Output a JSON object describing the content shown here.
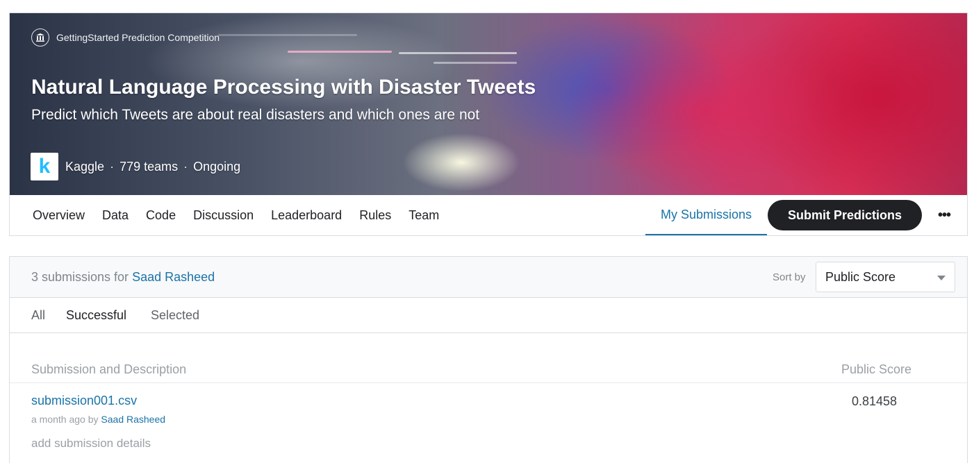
{
  "competition": {
    "category": "GettingStarted Prediction Competition",
    "category_icon": "bank-icon",
    "title": "Natural Language Processing with Disaster Tweets",
    "subtitle": "Predict which Tweets are about real disasters and which ones are not",
    "host_logo_letter": "k",
    "host": "Kaggle",
    "teams": "779 teams",
    "status": "Ongoing",
    "separator": "·"
  },
  "nav": {
    "tabs": [
      {
        "label": "Overview"
      },
      {
        "label": "Data"
      },
      {
        "label": "Code"
      },
      {
        "label": "Discussion"
      },
      {
        "label": "Leaderboard"
      },
      {
        "label": "Rules"
      },
      {
        "label": "Team"
      }
    ],
    "my_submissions": "My Submissions",
    "submit_button": "Submit Predictions",
    "more_icon": "more-horizontal-icon",
    "more_glyph": "•••"
  },
  "submissions": {
    "count_text": "3 submissions for",
    "user": "Saad Rasheed",
    "sort_label": "Sort by",
    "sort_value": "Public Score",
    "filters": [
      "All",
      "Successful",
      "Selected"
    ],
    "active_filter": "Successful",
    "columns": {
      "description": "Submission and Description",
      "score": "Public Score"
    },
    "rows": [
      {
        "file": "submission001.csv",
        "when": "a month ago by",
        "by": "Saad Rasheed",
        "details": "add submission details",
        "score": "0.81458"
      }
    ]
  },
  "colors": {
    "accent": "#1a73a8",
    "button_dark": "#202124",
    "kaggle_blue": "#20beff"
  }
}
